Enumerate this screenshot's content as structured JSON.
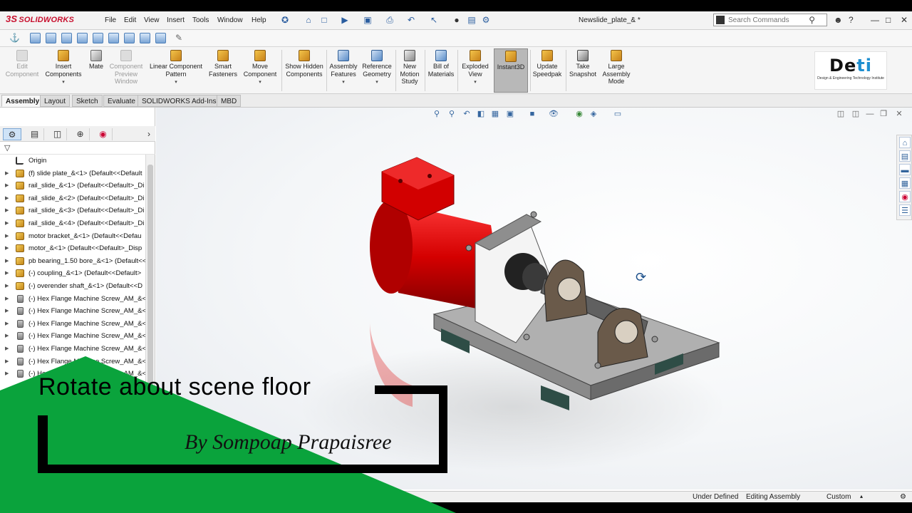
{
  "app": {
    "name": "SOLIDWORKS",
    "brand": "3S"
  },
  "menu": [
    "File",
    "Edit",
    "View",
    "Insert",
    "Tools",
    "Window",
    "Help"
  ],
  "document_title": "Newslide_plate_& *",
  "search": {
    "placeholder": "Search Commands"
  },
  "command_manager": [
    {
      "label": "Edit Component",
      "dim": true
    },
    {
      "label": "Insert Components",
      "dropdown": true
    },
    {
      "label": "Mate"
    },
    {
      "label": "Component Preview Window",
      "dim": true
    },
    {
      "label": "Linear Component Pattern",
      "dropdown": true
    },
    {
      "label": "Smart Fasteners"
    },
    {
      "label": "Move Component",
      "dropdown": true
    },
    {
      "label": "Show Hidden Components"
    },
    {
      "label": "Assembly Features",
      "dropdown": true
    },
    {
      "label": "Reference Geometry",
      "dropdown": true
    },
    {
      "label": "New Motion Study"
    },
    {
      "label": "Bill of Materials"
    },
    {
      "label": "Exploded View",
      "dropdown": true
    },
    {
      "label": "Instant3D",
      "active": true
    },
    {
      "label": "Update Speedpak"
    },
    {
      "label": "Take Snapshot"
    },
    {
      "label": "Large Assembly Mode"
    }
  ],
  "brand_logo": {
    "text_dark": "De",
    "text_accent": "ti",
    "subtitle": "Design & Engineering Technology Institute"
  },
  "tabs": [
    "Assembly",
    "Layout",
    "Sketch",
    "Evaluate",
    "SOLIDWORKS Add-Ins",
    "MBD"
  ],
  "active_tab": "Assembly",
  "feature_tree": [
    {
      "label": "Origin",
      "type": "origin"
    },
    {
      "label": "(f) slide plate_&<1> (Default<<Default",
      "type": "part"
    },
    {
      "label": "rail_slide_&<1> (Default<<Default>_Di",
      "type": "part"
    },
    {
      "label": "rail_slide_&<2> (Default<<Default>_Di",
      "type": "part"
    },
    {
      "label": "rail_slide_&<3> (Default<<Default>_Di",
      "type": "part"
    },
    {
      "label": "rail_slide_&<4> (Default<<Default>_Di",
      "type": "part"
    },
    {
      "label": "motor bracket_&<1> (Default<<Defau",
      "type": "part"
    },
    {
      "label": "motor_&<1> (Default<<Default>_Disp",
      "type": "part"
    },
    {
      "label": "pb bearing_1.50 bore_&<1> (Default<<",
      "type": "part"
    },
    {
      "label": "(-) coupling_&<1> (Default<<Default>",
      "type": "part"
    },
    {
      "label": "(-) overender shaft_&<1> (Default<<D",
      "type": "part"
    },
    {
      "label": "(-) Hex Flange Machine Screw_AM_&<",
      "type": "screw"
    },
    {
      "label": "(-) Hex Flange Machine Screw_AM_&<",
      "type": "screw"
    },
    {
      "label": "(-) Hex Flange Machine Screw_AM_&<",
      "type": "screw"
    },
    {
      "label": "(-) Hex Flange Machine Screw_AM_&<",
      "type": "screw"
    },
    {
      "label": "(-) Hex Flange Machine Screw_AM_&<",
      "type": "screw"
    },
    {
      "label": "(-) Hex Flange Machine Screw_AM_&<",
      "type": "screw"
    },
    {
      "label": "(-) Hex Flange Machine Screw_AM_&<",
      "type": "screw"
    }
  ],
  "status_bar": {
    "state": "Under Defined",
    "mode": "Editing Assembly",
    "units": "Custom"
  },
  "overlay": {
    "caption": "Rotate about scene floor",
    "byline": "By Sompoap Prapaisree"
  },
  "colors": {
    "brand_red": "#c8102e",
    "motor_red": "#cc0000",
    "overlay_green": "#0aa33c",
    "accent_blue": "#1f8fd0"
  },
  "icons": {
    "search": "magnifier-icon",
    "help": "question-icon",
    "user": "user-icon",
    "rotate_cursor": "rotate-scene-icon"
  }
}
